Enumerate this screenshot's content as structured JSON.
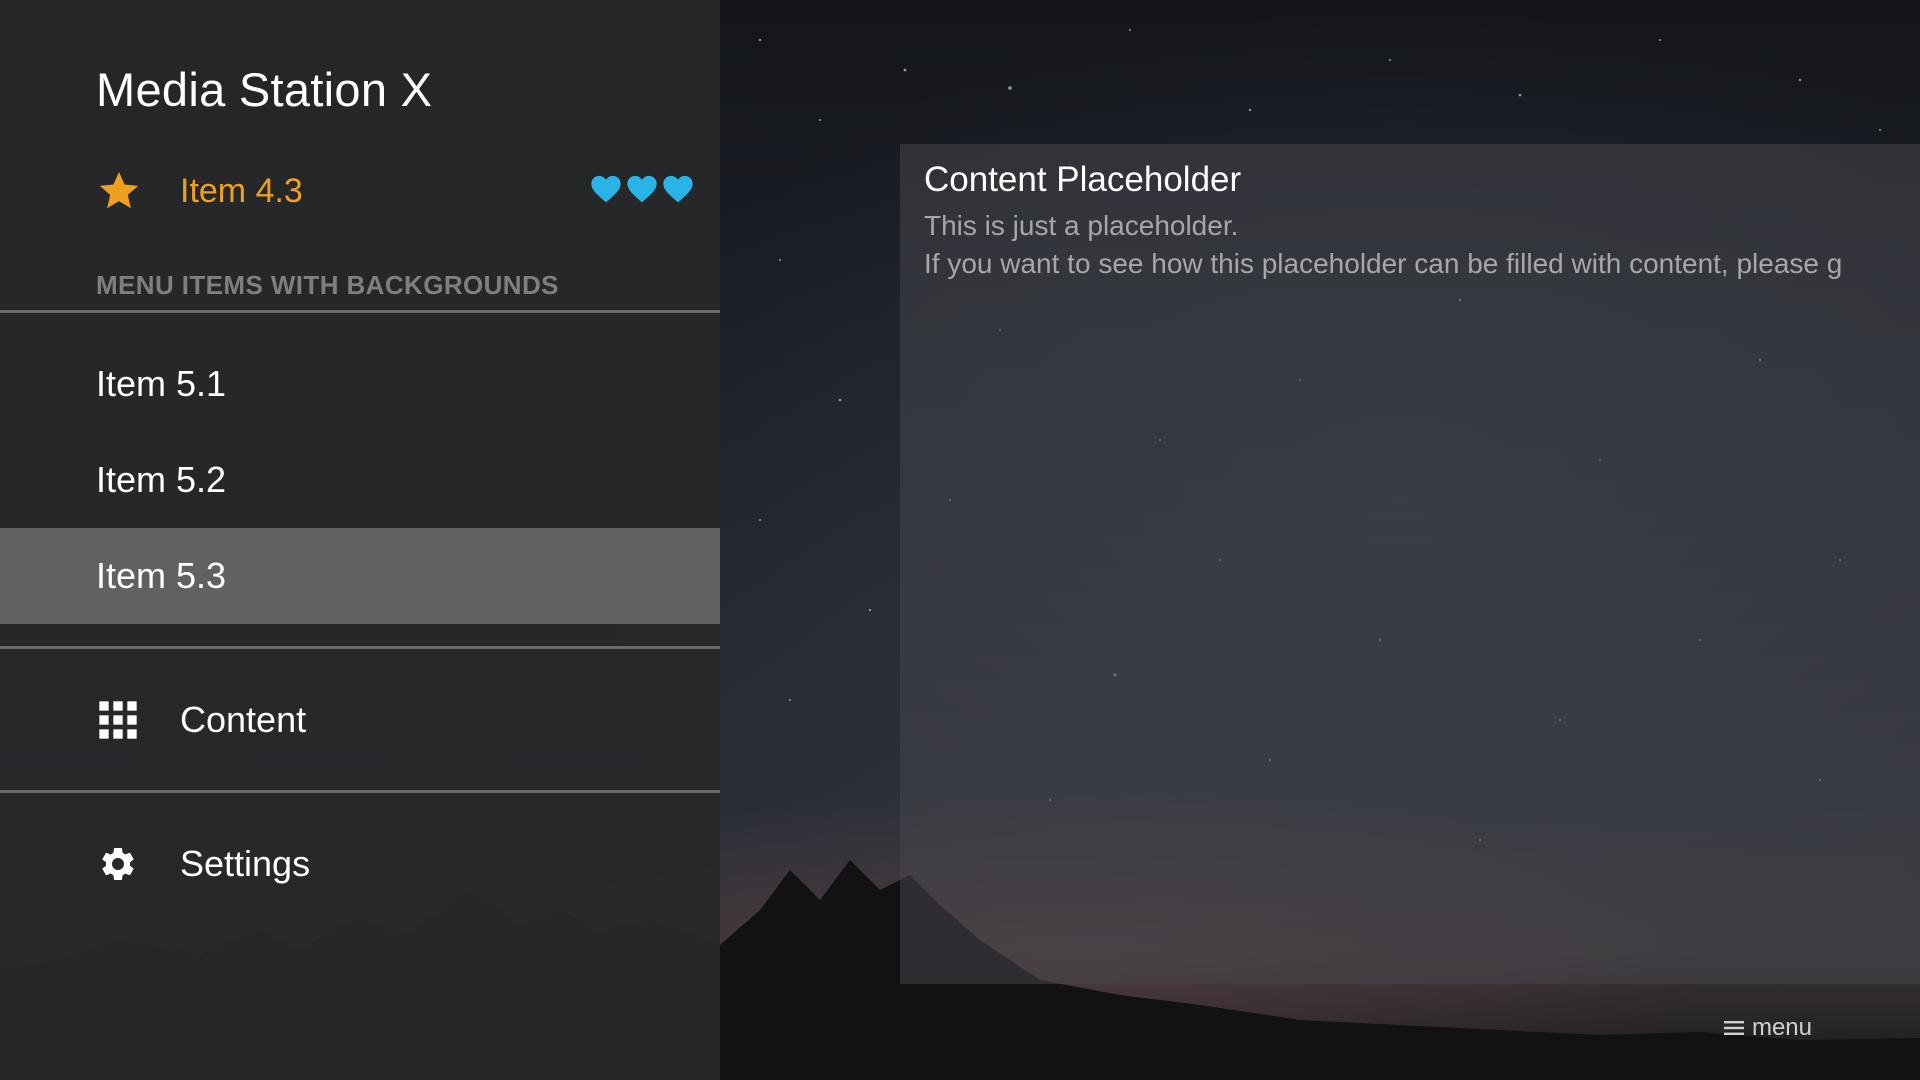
{
  "app": {
    "title": "Media Station X"
  },
  "focus_item": {
    "label": "Item 4.3",
    "icon": "star-icon",
    "badge_icons": [
      "heart-icon",
      "heart-icon",
      "heart-icon"
    ],
    "label_color": "#f0a020",
    "badge_color": "#2ab3e6"
  },
  "section": {
    "header": "MENU ITEMS WITH BACKGROUNDS"
  },
  "menu_items": [
    {
      "label": "Item 5.1",
      "selected": false
    },
    {
      "label": "Item 5.2",
      "selected": false
    },
    {
      "label": "Item 5.3",
      "selected": true
    }
  ],
  "nav": [
    {
      "label": "Content",
      "icon": "grid-icon"
    },
    {
      "label": "Settings",
      "icon": "gear-icon"
    }
  ],
  "content": {
    "title": "Content Placeholder",
    "lines": [
      "This is just a placeholder.",
      "If you want to see how this placeholder can be filled with content, please g"
    ]
  },
  "footer": {
    "menu_hint": "menu",
    "menu_icon": "hamburger-icon"
  }
}
